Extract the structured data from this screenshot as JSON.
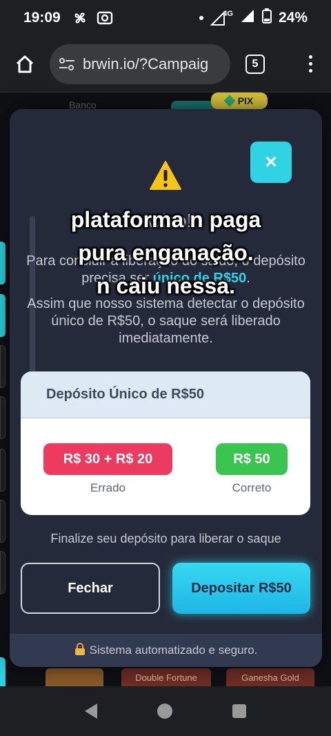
{
  "status": {
    "time": "19:09",
    "network": "4G",
    "battery": "24%"
  },
  "browser": {
    "url": "brwin.io/?Campaig",
    "tab_count": "5"
  },
  "background": {
    "tab_label": "Banco",
    "pix_label": "PIX",
    "games": [
      "Double Fortune",
      "Ganesha Gold"
    ]
  },
  "modal": {
    "close_symbol": "×",
    "title": "Aviso!",
    "message_part1": "Para concluir a liberação do saldo, o depósito precisa ser ",
    "message_highlight": "único de R$50",
    "message_part1_end": ".",
    "message_part2": "Assim que nosso sistema detectar o depósito único de R$50, o saque será liberado imediatamente.",
    "card": {
      "heading": "Depósito Único de R$50",
      "wrong_amount": "R$ 30 + R$ 20",
      "wrong_label": "Errado",
      "right_amount": "R$ 50",
      "right_label": "Correto"
    },
    "finalize_text": "Finalize seu depósito para liberar o saque",
    "close_button": "Fechar",
    "deposit_button": "Depositar R$50",
    "footer_text": "Sistema automatizado e seguro."
  },
  "overlay_caption": {
    "line1": "plataforma n paga",
    "line2": "pura enganação.",
    "line3": "n caiu nessa."
  },
  "colors": {
    "accent_cyan": "#2fd3e3",
    "wrong_red": "#ec3b5f",
    "right_green": "#39c54f",
    "modal_bg": "#252a3a"
  }
}
